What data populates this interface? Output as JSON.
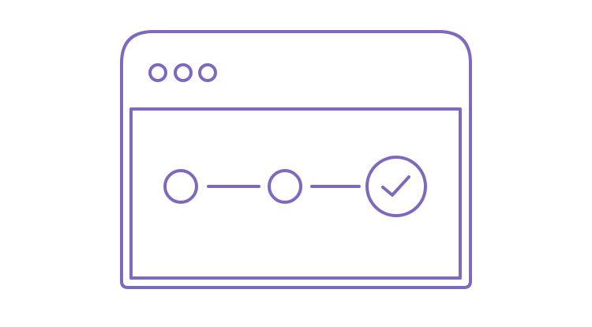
{
  "illustration": {
    "stroke_color": "#7f69bf",
    "window_controls": [
      "window-control-dot",
      "window-control-dot",
      "window-control-dot"
    ],
    "steps": [
      {
        "status": "pending",
        "icon": "step-circle-icon"
      },
      {
        "status": "pending",
        "icon": "step-circle-icon"
      },
      {
        "status": "complete",
        "icon": "checkmark-circle-icon"
      }
    ]
  }
}
